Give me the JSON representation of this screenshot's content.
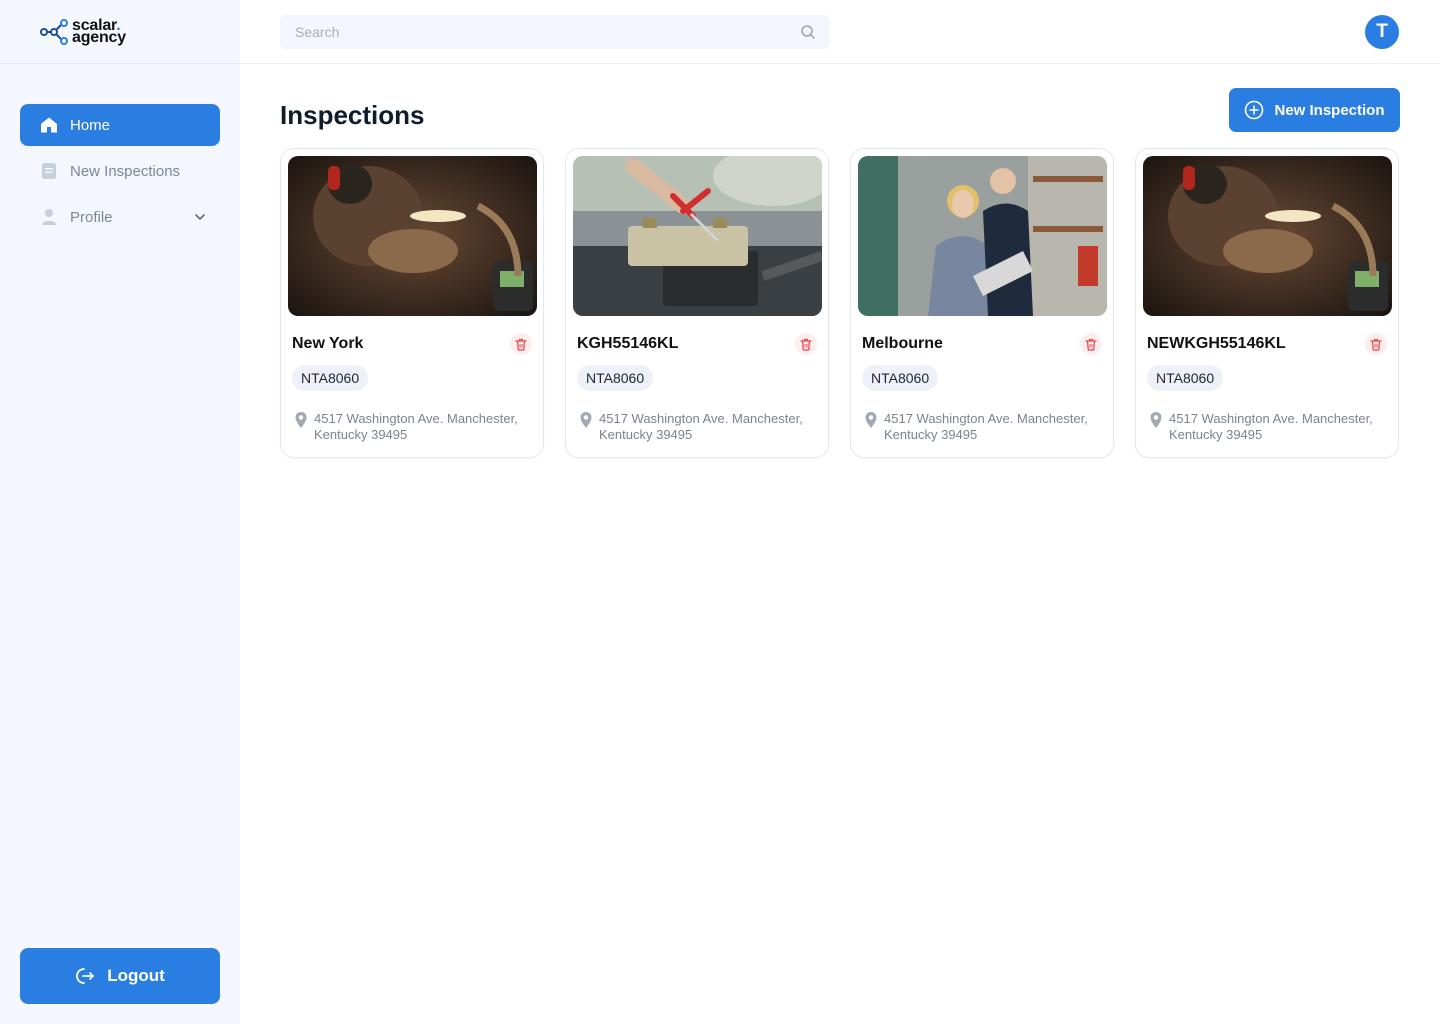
{
  "brand": {
    "line1": "scalar",
    "dot": ".",
    "line2": "agency",
    "accent": "#2a7de1"
  },
  "sidebar": {
    "items": [
      {
        "label": "Home",
        "icon": "home-icon",
        "active": true
      },
      {
        "label": "New Inspections",
        "icon": "document-icon",
        "active": false
      },
      {
        "label": "Profile",
        "icon": "user-icon",
        "active": false,
        "has_dropdown": true
      }
    ],
    "logout_label": "Logout"
  },
  "header": {
    "search_placeholder": "Search",
    "avatar_initial": "T"
  },
  "main": {
    "title": "Inspections",
    "new_button_label": "New Inspection",
    "cards": [
      {
        "title": "New York",
        "code": "NTA8060",
        "address": "4517 Washington Ave. Manchester, Kentucky 39495",
        "image": "worker-with-magnifier-lamp"
      },
      {
        "title": "KGH55146KL",
        "code": "NTA8060",
        "address": "4517 Washington Ave. Manchester, Kentucky 39495",
        "image": "car-battery-with-pliers"
      },
      {
        "title": "Melbourne",
        "code": "NTA8060",
        "address": "4517 Washington Ave. Manchester, Kentucky 39495",
        "image": "warehouse-workers-with-laptop"
      },
      {
        "title": "NEWKGH55146KL",
        "code": "NTA8060",
        "address": "4517 Washington Ave. Manchester, Kentucky 39495",
        "image": "worker-with-magnifier-lamp"
      }
    ]
  },
  "colors": {
    "primary": "#2a7de1",
    "sidebar_bg": "#f4f7fd",
    "danger": "#e5484d"
  }
}
